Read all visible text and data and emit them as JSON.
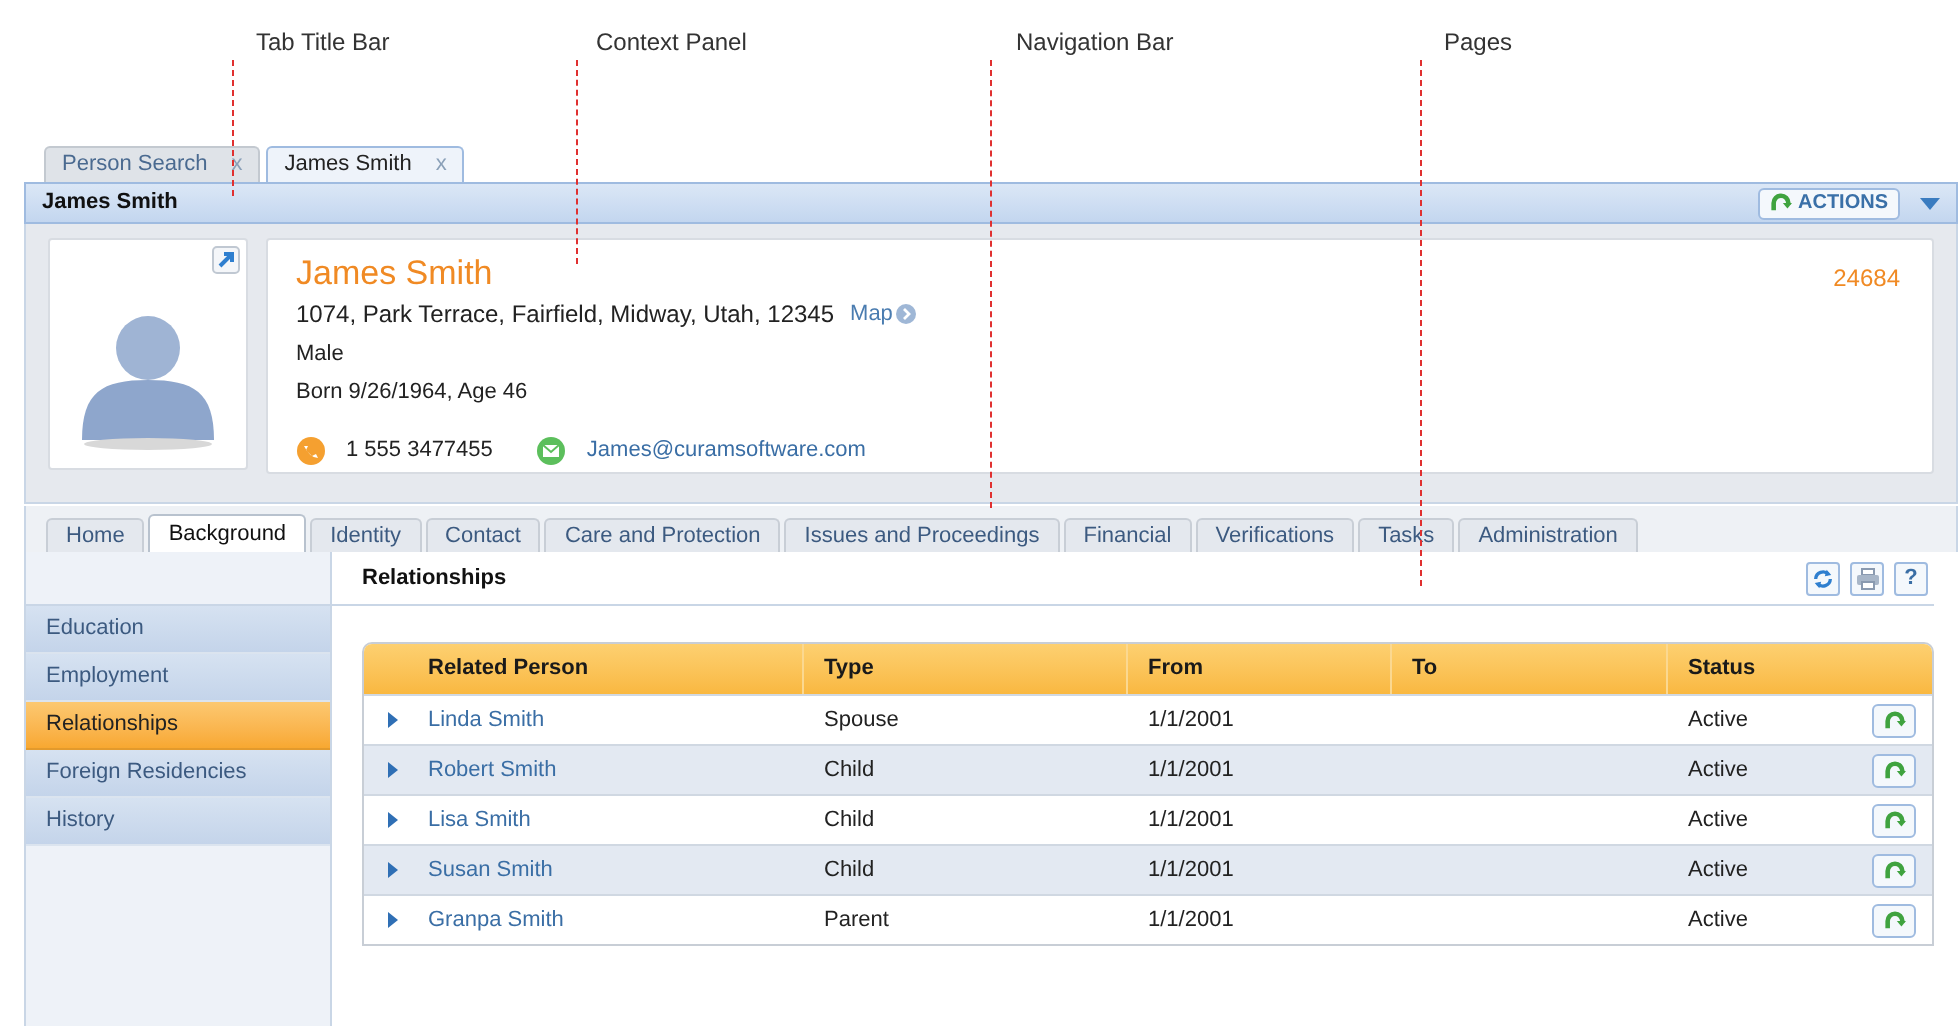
{
  "annotations": [
    {
      "label": "Tab Title Bar"
    },
    {
      "label": "Context Panel"
    },
    {
      "label": "Navigation Bar"
    },
    {
      "label": "Pages"
    }
  ],
  "tabs": [
    {
      "label": "Person Search",
      "close": "x",
      "selected": false
    },
    {
      "label": "James Smith",
      "close": "x",
      "selected": true
    }
  ],
  "header": {
    "title": "James Smith",
    "actions": "ACTIONS"
  },
  "person": {
    "name": "James Smith",
    "address": "1074, Park Terrace, Fairfield, Midway, Utah, 12345",
    "map_link": "Map",
    "gender": "Male",
    "born": "Born 9/26/1964, Age 46",
    "phone": "1 555 3477455",
    "email": "James@curamsoftware.com",
    "reference": "24684"
  },
  "nav_tabs": [
    {
      "label": "Home",
      "selected": false
    },
    {
      "label": "Background",
      "selected": true
    },
    {
      "label": "Identity",
      "selected": false
    },
    {
      "label": "Contact",
      "selected": false
    },
    {
      "label": "Care and Protection",
      "selected": false
    },
    {
      "label": "Issues and Proceedings",
      "selected": false
    },
    {
      "label": "Financial",
      "selected": false
    },
    {
      "label": "Verifications",
      "selected": false
    },
    {
      "label": "Tasks",
      "selected": false
    },
    {
      "label": "Administration",
      "selected": false
    }
  ],
  "sidebar": {
    "items": [
      {
        "label": "Education",
        "selected": false
      },
      {
        "label": "Employment",
        "selected": false
      },
      {
        "label": "Relationships",
        "selected": true
      },
      {
        "label": "Foreign Residencies",
        "selected": false
      },
      {
        "label": "History",
        "selected": false
      }
    ]
  },
  "page": {
    "title": "Relationships",
    "help": "?"
  },
  "table": {
    "columns": [
      "Related Person",
      "Type",
      "From",
      "To",
      "Status"
    ],
    "rows": [
      {
        "related_person": "Linda Smith",
        "type": "Spouse",
        "from": "1/1/2001",
        "to": "",
        "status": "Active"
      },
      {
        "related_person": "Robert Smith",
        "type": "Child",
        "from": "1/1/2001",
        "to": "",
        "status": "Active"
      },
      {
        "related_person": "Lisa Smith",
        "type": "Child",
        "from": "1/1/2001",
        "to": "",
        "status": "Active"
      },
      {
        "related_person": "Susan Smith",
        "type": "Child",
        "from": "1/1/2001",
        "to": "",
        "status": "Active"
      },
      {
        "related_person": "Granpa Smith",
        "type": "Parent",
        "from": "1/1/2001",
        "to": "",
        "status": "Active"
      }
    ]
  }
}
